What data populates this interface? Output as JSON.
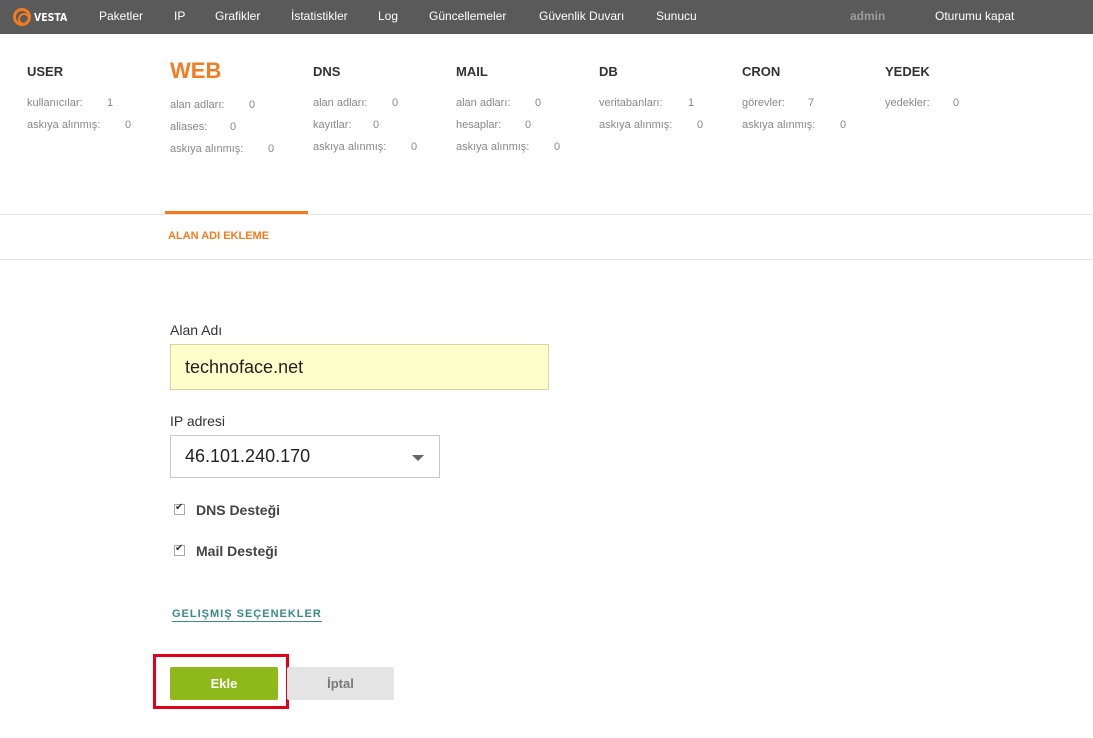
{
  "logo": {
    "text": "VESTA"
  },
  "nav": {
    "items": [
      "Paketler",
      "IP",
      "Grafikler",
      "İstatistikler",
      "Log",
      "Güncellemeler",
      "Güvenlik Duvarı",
      "Sunucu"
    ],
    "user": "admin",
    "logout": "Oturumu kapat"
  },
  "stats": [
    {
      "title": "USER",
      "rows": [
        {
          "label": "kullanıcılar:",
          "value": "1"
        },
        {
          "label": "askıya alınmış:",
          "value": "0"
        }
      ]
    },
    {
      "title": "WEB",
      "rows": [
        {
          "label": "alan adları:",
          "value": "0"
        },
        {
          "label": "aliases:",
          "value": "0"
        },
        {
          "label": "askıya alınmış:",
          "value": "0"
        }
      ]
    },
    {
      "title": "DNS",
      "rows": [
        {
          "label": "alan adları:",
          "value": "0"
        },
        {
          "label": "kayıtlar:",
          "value": "0"
        },
        {
          "label": "askıya alınmış:",
          "value": "0"
        }
      ]
    },
    {
      "title": "MAIL",
      "rows": [
        {
          "label": "alan adları:",
          "value": "0"
        },
        {
          "label": "hesaplar:",
          "value": "0"
        },
        {
          "label": "askıya alınmış:",
          "value": "0"
        }
      ]
    },
    {
      "title": "DB",
      "rows": [
        {
          "label": "veritabanları:",
          "value": "1"
        },
        {
          "label": "askıya alınmış:",
          "value": "0"
        }
      ]
    },
    {
      "title": "CRON",
      "rows": [
        {
          "label": "görevler:",
          "value": "7"
        },
        {
          "label": "askıya alınmış:",
          "value": "0"
        }
      ]
    },
    {
      "title": "YEDEK",
      "rows": [
        {
          "label": "yedekler:",
          "value": "0"
        }
      ]
    }
  ],
  "section": {
    "title": "ALAN ADI EKLEME"
  },
  "form": {
    "domain_label": "Alan Adı",
    "domain_value": "technoface.net",
    "ip_label": "IP adresi",
    "ip_value": "46.101.240.170",
    "dns_label": "DNS Desteği",
    "mail_label": "Mail Desteği",
    "advanced_link": "GELIŞMIŞ SEÇENEKLER",
    "add_button": "Ekle",
    "cancel_button": "İptal"
  },
  "colors": {
    "accent": "#f47b20",
    "add_button": "#8fb81a",
    "topbar": "#5a5a5a",
    "input_bg": "#ffffcc",
    "highlight": "#e3001b"
  }
}
